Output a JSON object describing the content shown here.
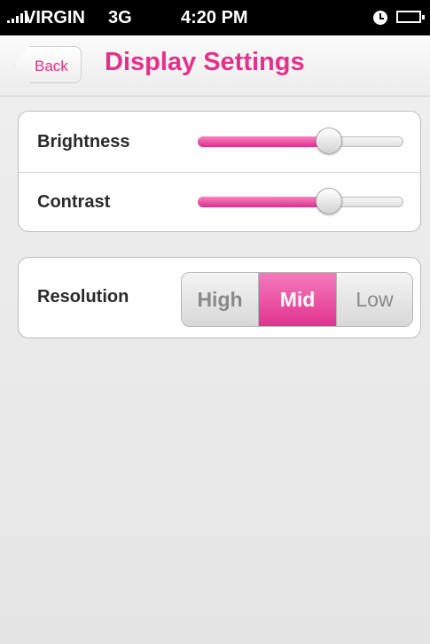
{
  "status_bar": {
    "carrier": "VIRGIN",
    "network": "3G",
    "time": "4:20 PM",
    "signal_icon": "signal-bars-icon",
    "clock_icon": "clock-icon",
    "battery_icon": "battery-icon"
  },
  "nav": {
    "back_label": "Back",
    "title": "Display Settings"
  },
  "settings": {
    "brightness": {
      "label": "Brightness",
      "level": 0.64
    },
    "contrast": {
      "label": "Contrast",
      "level": 0.64
    },
    "resolution": {
      "label": "Resolution",
      "options": [
        "High",
        "Mid",
        "Low"
      ],
      "selected": "Mid"
    }
  },
  "colors": {
    "accent": "#e6308a",
    "slider_fill": "#e6308a",
    "segment_selected": "#e6308a"
  }
}
